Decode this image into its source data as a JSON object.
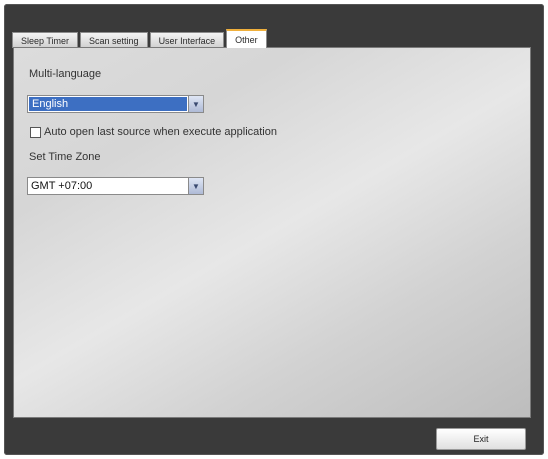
{
  "tabs": [
    {
      "label": "Sleep Timer"
    },
    {
      "label": "Scan setting"
    },
    {
      "label": "User Interface"
    },
    {
      "label": "Other"
    }
  ],
  "active_tab": "Other",
  "multi_language": {
    "label": "Multi-language",
    "selected": "English"
  },
  "auto_open": {
    "label": "Auto open last source when execute application",
    "checked": false
  },
  "time_zone": {
    "label": "Set Time Zone",
    "selected": "GMT +07:00"
  },
  "footer": {
    "exit_label": "Exit"
  },
  "colors": {
    "active_tab_accent": "#f0b03c",
    "selection_highlight": "#3d6fc2"
  },
  "icons": [
    "dropdown-arrow-icon",
    "checkbox-icon"
  ]
}
